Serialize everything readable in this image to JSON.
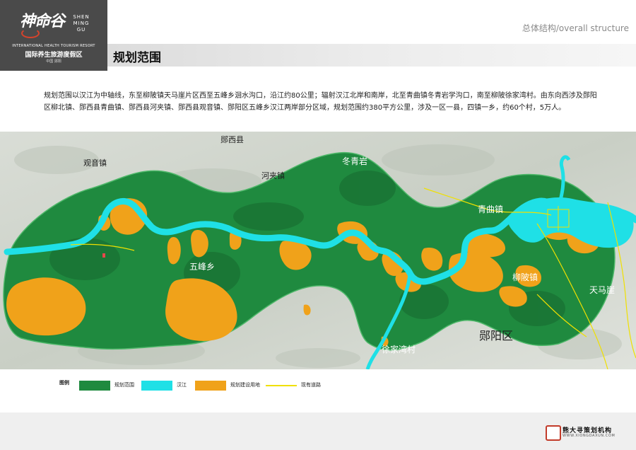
{
  "brand": {
    "logo_cn": "神命谷",
    "logo_en_lines": [
      "SHEN",
      "MING",
      "GU"
    ],
    "tagline_en": "INTERNATIONAL HEALTH TOURISM RESORT",
    "tagline_cn": "国际养生旅游度假区",
    "location": "中国 郧阳"
  },
  "header": {
    "section": "总体结构/overall structure",
    "title": "规划范围"
  },
  "description": "规划范围以汉江为中轴线，东至柳陂镇天马崖片区西至五峰乡洄水沟口，沿江约80公里；辐射汉江北岸和南岸，北至青曲镇冬青岩学沟口，南至柳陂徐家湾村。由东向西涉及郧阳区柳北镇、郧西县青曲镇、郧西县河夹镇、郧西县观音镇、郧阳区五峰乡汉江两岸部分区域，规划范围约380平方公里，涉及一区一县，四镇一乡，约60个村，5万人。",
  "map": {
    "labels": {
      "yunxi_county": "郧西县",
      "guanyin_town": "观音镇",
      "hejia_town": "河夹镇",
      "dongqingyan": "冬青岩",
      "qingqu_town": "青曲镇",
      "wufeng_township": "五峰乡",
      "liubei_town": "柳陂镇",
      "tianmaya": "天马崖",
      "yunyang_district": "郧阳区",
      "xujiawan_village": "徐家湾村"
    },
    "colors": {
      "planning_area": "#1f8a3f",
      "river": "#1fe0e6",
      "construction_land": "#f0a21a",
      "road": "#f0e000"
    }
  },
  "legend": {
    "title": "图例",
    "items": [
      {
        "label": "规划范围",
        "color": "#1f8a3f"
      },
      {
        "label": "汉江",
        "color": "#1fe0e6"
      },
      {
        "label": "规划建设用地",
        "color": "#f0a21a"
      },
      {
        "label": "现有道路",
        "color": "#f0e000"
      }
    ]
  },
  "footer": {
    "company_cn": "熊大寻策划机构",
    "company_url": "WWW.XIONGDAXUN.COM"
  }
}
